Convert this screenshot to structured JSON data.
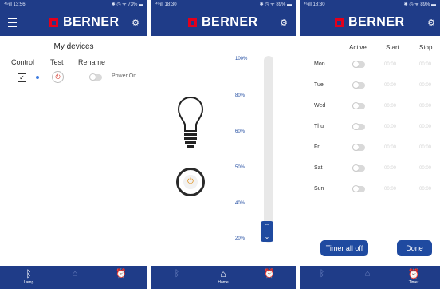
{
  "brand": {
    "name": "BERNER",
    "red": "#e3001b",
    "blue": "#1f3c88"
  },
  "phones": [
    {
      "status_left": "⁴ᴳıll 13:56",
      "status_right": "✱ ◷ ᯤ 73% ▬",
      "header": {
        "menu_icon": "hamburger-icon",
        "settings_icon": "gear-icon"
      },
      "title": "My devices",
      "columns": {
        "control": "Control",
        "test": "Test",
        "rename": "Rename"
      },
      "device": {
        "checked": true,
        "power_state": "Power On"
      },
      "nav": [
        {
          "label": "Lamp",
          "icon": "bluetooth-icon",
          "active": true
        },
        {
          "label": "",
          "icon": "home-icon",
          "active": false
        },
        {
          "label": "",
          "icon": "alarm-clock-icon",
          "active": false
        }
      ]
    },
    {
      "status_left": "⁴ᴳıll 18:30",
      "status_right": "✱ ◷ ᯤ 89% ▬",
      "dimmer_levels": [
        "100%",
        "80%",
        "60%",
        "50%",
        "40%",
        "20%"
      ],
      "nav": [
        {
          "label": "",
          "icon": "bluetooth-icon",
          "active": false
        },
        {
          "label": "Home",
          "icon": "home-icon",
          "active": true
        },
        {
          "label": "",
          "icon": "alarm-clock-icon",
          "active": false
        }
      ]
    },
    {
      "status_left": "⁴ᴳıll 18:30",
      "status_right": "✱ ◷ ᯤ 89% ▬",
      "columns": {
        "active": "Active",
        "start": "Start",
        "stop": "Stop"
      },
      "days": [
        {
          "day": "Mon",
          "start": "00:00",
          "stop": "00:00"
        },
        {
          "day": "Tue",
          "start": "00:00",
          "stop": "00:00"
        },
        {
          "day": "Wed",
          "start": "00:00",
          "stop": "00:00"
        },
        {
          "day": "Thu",
          "start": "00:00",
          "stop": "00:00"
        },
        {
          "day": "Fri",
          "start": "00:00",
          "stop": "00:00"
        },
        {
          "day": "Sat",
          "start": "00:00",
          "stop": "00:00"
        },
        {
          "day": "Sun",
          "start": "00:00",
          "stop": "00:00"
        }
      ],
      "buttons": {
        "timer_all_off": "Timer all off",
        "done": "Done"
      },
      "nav": [
        {
          "label": "",
          "icon": "bluetooth-icon",
          "active": false
        },
        {
          "label": "",
          "icon": "home-icon",
          "active": false
        },
        {
          "label": "Timer",
          "icon": "alarm-clock-icon",
          "active": true
        }
      ]
    }
  ]
}
